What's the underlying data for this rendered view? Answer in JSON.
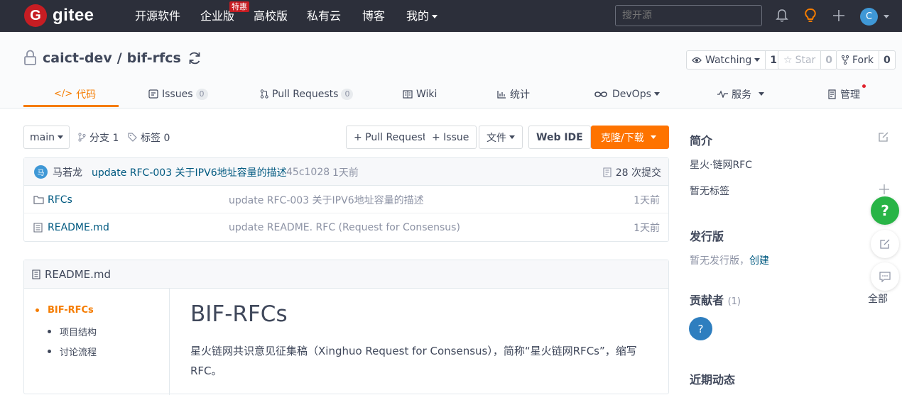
{
  "colors": {
    "nav_bg": "#2c2f3a",
    "brand": "#c71d23",
    "accent": "#f57c00",
    "link": "#005980",
    "help_green": "#28b446",
    "avatar_blue": "#3f98d6"
  },
  "nav": {
    "logo_letter": "G",
    "logo_text": "gitee",
    "links": [
      "开源软件",
      "企业版",
      "高校版",
      "私有云",
      "博客",
      "我的"
    ],
    "promo_badge": "特惠",
    "search_placeholder": "搜开源",
    "avatar_letter": "C"
  },
  "repo": {
    "owner": "caict-dev",
    "separator": "/",
    "name": "bif-rfcs",
    "watch_label": "Watching",
    "watch_count": "1",
    "star_label": "Star",
    "star_count": "0",
    "fork_label": "Fork",
    "fork_count": "0"
  },
  "tabs": [
    {
      "label": "代码",
      "icon": "code-icon"
    },
    {
      "label": "Issues",
      "count": "0",
      "icon": "issues-icon"
    },
    {
      "label": "Pull Requests",
      "count": "0",
      "icon": "pull-request-icon"
    },
    {
      "label": "Wiki",
      "icon": "wiki-icon"
    },
    {
      "label": "统计",
      "icon": "stats-icon"
    },
    {
      "label": "DevOps",
      "icon": "devops-icon"
    },
    {
      "label": "服务",
      "icon": "service-icon"
    },
    {
      "label": "管理",
      "icon": "manage-icon"
    }
  ],
  "toolbar": {
    "branch": "main",
    "branches_label": "分支 1",
    "tags_label": "标签 0",
    "pull_request_btn": "+ Pull Request",
    "issue_btn": "+ Issue",
    "file_btn": "文件",
    "webide_btn": "Web IDE",
    "clone_btn": "克隆/下载"
  },
  "commit": {
    "author_initial": "马",
    "author": "马若龙",
    "message": "update RFC-003 关于IPV6地址容量的描述",
    "hash": "45c1028",
    "time": "1天前",
    "commits_label": "28 次提交"
  },
  "files": [
    {
      "name": "RFCs",
      "type": "folder",
      "message": "update RFC-003 关于IPV6地址容量的描述",
      "time": "1天前"
    },
    {
      "name": "README.md",
      "type": "file",
      "message": "update README. RFC (Request for Consensus)",
      "time": "1天前"
    }
  ],
  "readme": {
    "filename": "README.md",
    "toc": [
      "BIF-RFCs",
      "项目结构",
      "讨论流程"
    ],
    "title": "BIF-RFCs",
    "paragraph": "星火链网共识意见征集稿（Xinghuo Request for Consensus），简称“星火链网RFCs”，缩写RFC。"
  },
  "sidebar": {
    "intro_heading": "简介",
    "intro_text": "星火·链网RFC",
    "no_tags": "暂无标签",
    "release_heading": "发行版",
    "no_release": "暂无发行版，",
    "create_link": "创建",
    "contributors_heading": "贡献者",
    "contributors_count": "(1)",
    "all_link": "全部",
    "contributor_avatar": "?",
    "activity_heading": "近期动态"
  },
  "float": {
    "help": "?"
  }
}
